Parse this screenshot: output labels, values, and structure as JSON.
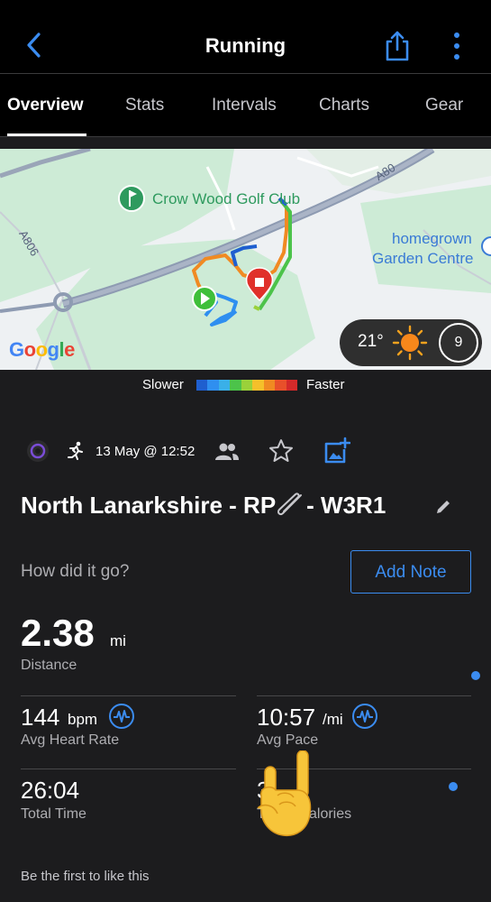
{
  "header": {
    "title": "Running",
    "back_icon": "chevron-left-icon",
    "share_icon": "share-icon",
    "more_icon": "more-vertical-icon",
    "accent_color": "#3b8cf0"
  },
  "tabs": [
    {
      "label": "Overview",
      "active": true
    },
    {
      "label": "Stats",
      "active": false
    },
    {
      "label": "Intervals",
      "active": false
    },
    {
      "label": "Charts",
      "active": false
    },
    {
      "label": "Gear",
      "active": false
    }
  ],
  "map": {
    "labels": {
      "golf_club": "Crow Wood Golf Club",
      "road_a80": "A80",
      "road_a806": "A806",
      "garden_centre_line1": "homegrown",
      "garden_centre_line2": "Garden Centre"
    },
    "attribution": "Google",
    "weather": {
      "temperature": "21°",
      "condition_icon": "sun-icon",
      "wind": "9"
    }
  },
  "pace_legend": {
    "slower": "Slower",
    "faster": "Faster",
    "colors": [
      "#1f5fcf",
      "#2f8ff0",
      "#3ab0e8",
      "#4cc34a",
      "#9ad13a",
      "#f5c02a",
      "#f08a22",
      "#e8502a",
      "#d42a2a"
    ]
  },
  "meta": {
    "date": "13 May @ 12:52",
    "device_icon": "watch-icon",
    "activity_icon": "running-icon",
    "people_icon": "people-icon",
    "star_icon": "star-icon",
    "photo_icon": "add-photo-icon"
  },
  "activity": {
    "name_part1": "North Lanarkshire - RP",
    "name_emoji": "paperclip-icon",
    "name_part2": "- W3R1"
  },
  "feedback": {
    "prompt": "How did it go?",
    "add_note_label": "Add Note"
  },
  "stats": {
    "distance": {
      "value": "2.38",
      "unit": "mi",
      "label": "Distance"
    },
    "heart_rate": {
      "value": "144",
      "unit": "bpm",
      "label": "Avg Heart Rate"
    },
    "pace": {
      "value": "10:57",
      "unit": "/mi",
      "label": "Avg Pace"
    },
    "time": {
      "value": "26:04",
      "label": "Total Time"
    },
    "calories": {
      "value": "3",
      "label": "To",
      "label_tail": "alories"
    }
  },
  "footer": {
    "like_text": "Be the first to like this"
  }
}
